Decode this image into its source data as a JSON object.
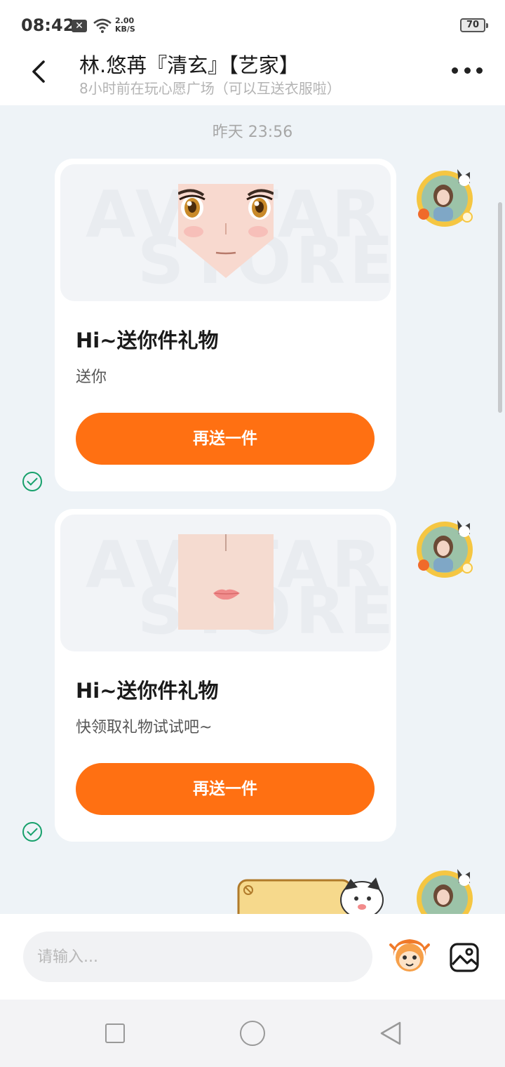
{
  "status_bar": {
    "time": "08:42",
    "notification_badge": "✕",
    "network_speed_value": "2.00",
    "network_speed_unit": "KB/S",
    "battery": "70"
  },
  "header": {
    "title": "林.悠苒『清玄』【艺家】",
    "subtitle": "8小时前在玩心愿广场（可以互送衣服啦）",
    "back_icon": "chevron-left-icon",
    "more_icon": "more-dots-icon"
  },
  "chat": {
    "timestamp": "昨天 23:56",
    "watermark_line1": "AVATAR",
    "watermark_line2": "STORE",
    "messages": [
      {
        "title": "Hi~送你件礼物",
        "desc": "送你",
        "button": "再送一件",
        "item": "eyes-face-item",
        "status": "read-check-icon"
      },
      {
        "title": "Hi~送你件礼物",
        "desc": "快领取礼物试试吧~",
        "button": "再送一件",
        "item": "lips-item",
        "status": "read-check-icon"
      }
    ]
  },
  "input": {
    "placeholder": "请输入..."
  },
  "colors": {
    "accent": "#ff7012",
    "check": "#16a06b",
    "chat_bg": "#eef3f7"
  }
}
